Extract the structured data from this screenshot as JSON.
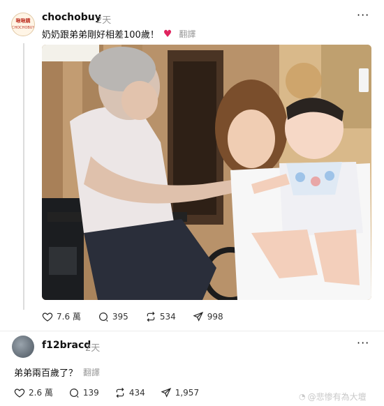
{
  "post": {
    "username": "chochobuy",
    "time": "2天",
    "more": "···",
    "avatar": {
      "logo_top": "啾啾購",
      "logo_bottom": "CHOCHOBUY"
    },
    "caption": "奶奶跟弟弟剛好相差100歲！",
    "caption_emoji": "heart",
    "translate": "翻譯",
    "stats": {
      "likes": "7.6 萬",
      "comments": "395",
      "reposts": "534",
      "shares": "998"
    }
  },
  "reply": {
    "username": "f12bracd",
    "time": "2天",
    "more": "···",
    "text": "弟弟兩百歲了？",
    "translate": "翻譯",
    "stats": {
      "likes": "2.6 萬",
      "comments": "139",
      "reposts": "434",
      "shares": "1,957"
    }
  },
  "watermark": {
    "text": "@悲惨有為大壇"
  },
  "colors": {
    "heart": "#e0245e",
    "muted": "#999999",
    "divider": "#ececec"
  }
}
